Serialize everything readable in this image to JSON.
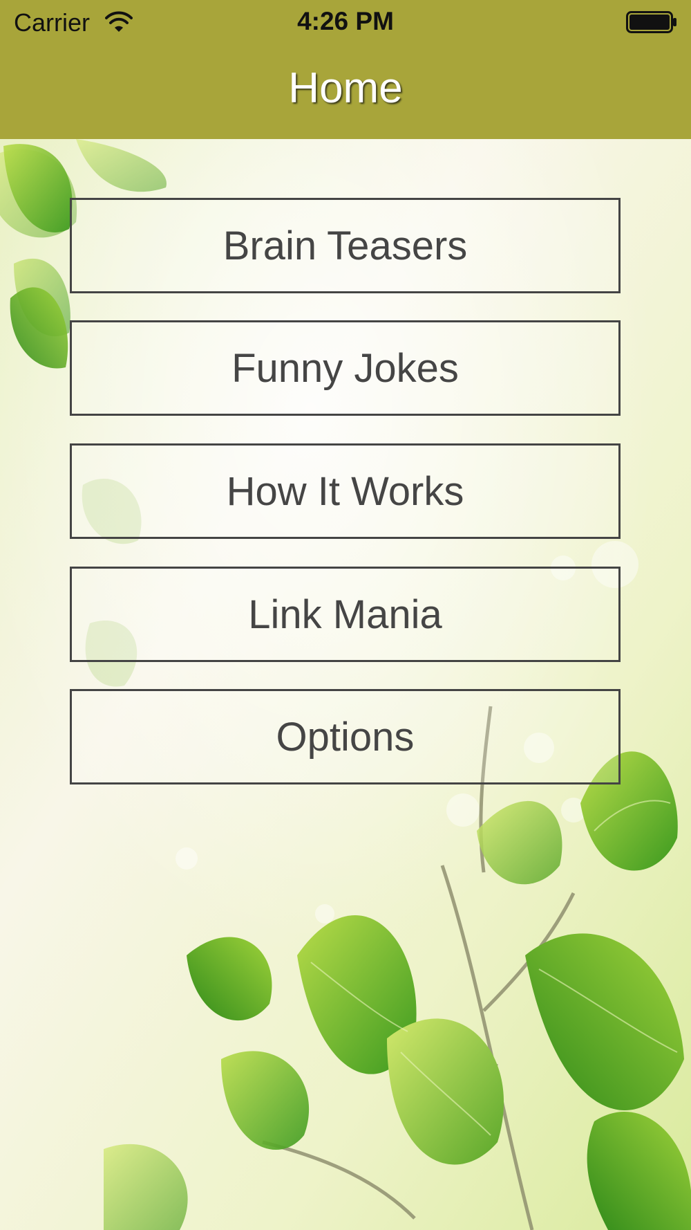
{
  "status_bar": {
    "carrier": "Carrier",
    "time": "4:26 PM",
    "icons": [
      "wifi-icon",
      "battery-icon"
    ]
  },
  "header": {
    "title": "Home"
  },
  "menu": {
    "items": [
      {
        "label": "Brain Teasers"
      },
      {
        "label": "Funny Jokes"
      },
      {
        "label": "How It Works"
      },
      {
        "label": "Link Mania"
      },
      {
        "label": "Options"
      }
    ]
  },
  "colors": {
    "navbar": "#a8a53a",
    "button_border": "#444444",
    "button_text": "#454545",
    "leaf_green": "#6ab52c"
  }
}
